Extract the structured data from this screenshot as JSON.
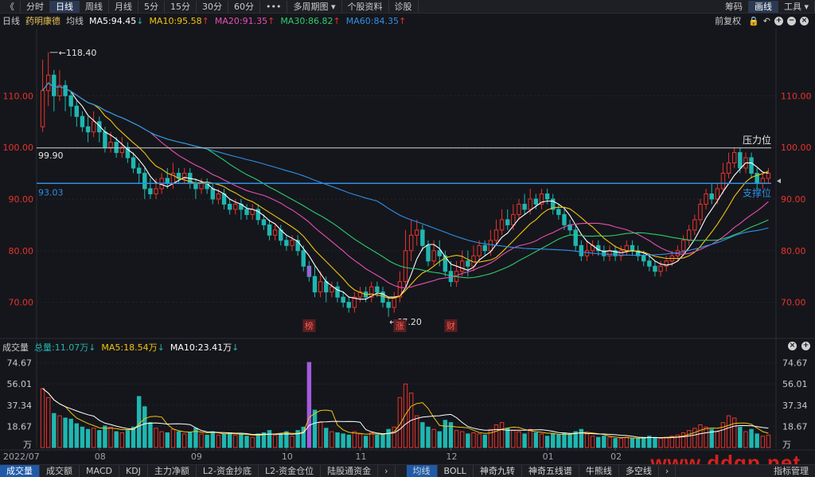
{
  "toolbar": {
    "back": "《",
    "items": [
      "分时",
      "日线",
      "周线",
      "月线",
      "5分",
      "15分",
      "30分",
      "60分",
      "•••",
      "多周期图 ▾",
      "个股资料",
      "诊股"
    ],
    "active_index": 1,
    "right_items": [
      "筹码",
      "画线",
      "工具 ▾"
    ],
    "right_active_index": 1
  },
  "ma_bar": {
    "period": "日线",
    "name": "药明康德",
    "type": "均线",
    "ma5": "MA5:94.45",
    "ma10": "MA10:95.58",
    "ma20": "MA20:91.35",
    "ma30": "MA30:86.82",
    "ma60": "MA60:84.35",
    "adjust": "前复权"
  },
  "vol_bar": {
    "label": "成交量",
    "total": "总量:11.07万",
    "ma5": "MA5:18.54万",
    "ma10": "MA10:23.41万"
  },
  "colors": {
    "up": "#e8332d",
    "down": "#1fb7b1",
    "ma5": "#ffffff",
    "ma10": "#f1c40f",
    "ma20": "#e84fb3",
    "ma30": "#2ecc71",
    "ma60": "#2f8fe8",
    "support": "#2f8fe8",
    "pressure": "#d0d0d0"
  },
  "bottom_tabs": [
    "成交量",
    "成交额",
    "MACD",
    "KDJ",
    "主力净额",
    "L2-资金抄底",
    "L2-资金仓位",
    "陆股通资金"
  ],
  "bottom_tabs2": [
    "均线",
    "BOLL",
    "神奇九转",
    "神奇五线谱",
    "牛熊线",
    "多空线"
  ],
  "bottom_right": "指标管理",
  "watermark": "www.ddgp.net",
  "chart_data": {
    "type": "candlestick",
    "title": "药明康德",
    "x_labels": [
      "2022/07",
      "08",
      "09",
      "10",
      "11",
      "12",
      "01",
      "02"
    ],
    "price_ticks": [
      110.0,
      100.0,
      90.0,
      80.0,
      70.0
    ],
    "ylim": [
      63.0,
      123.0
    ],
    "volume_ticks": [
      "74.67",
      "56.01",
      "37.34",
      "18.67",
      "万"
    ],
    "volume_ylim": [
      0,
      80
    ],
    "annotations": {
      "high": "118.40",
      "low": "67.20",
      "pressure_value": "99.90",
      "pressure_label": "压力位",
      "support_value": "93.03",
      "support_label": "支撑位",
      "events": [
        "榜",
        "涨",
        "财"
      ]
    },
    "candles": [
      [
        104,
        111,
        117,
        103,
        52
      ],
      [
        111,
        114,
        118.4,
        108,
        44
      ],
      [
        114,
        110,
        115,
        107,
        30
      ],
      [
        110,
        112,
        115,
        109,
        28
      ],
      [
        112,
        110,
        113,
        107,
        26
      ],
      [
        110,
        108,
        111,
        106,
        25
      ],
      [
        108,
        106,
        109,
        104,
        21
      ],
      [
        106,
        104,
        107,
        103,
        18
      ],
      [
        104,
        103,
        106,
        101,
        16
      ],
      [
        103,
        105,
        107,
        102,
        17
      ],
      [
        105,
        103,
        106,
        101,
        15
      ],
      [
        103,
        100,
        104,
        99,
        19
      ],
      [
        100,
        101,
        103,
        99,
        18
      ],
      [
        101,
        99,
        102,
        98,
        14
      ],
      [
        99,
        100,
        102,
        98,
        13
      ],
      [
        100,
        98,
        101,
        97,
        15
      ],
      [
        98,
        96,
        99,
        95,
        18
      ],
      [
        96,
        95,
        97,
        93,
        45
      ],
      [
        95,
        92,
        96,
        90,
        36
      ],
      [
        92,
        91,
        94,
        90,
        22
      ],
      [
        91,
        92,
        94,
        90,
        17
      ],
      [
        92,
        94,
        95,
        91,
        14
      ],
      [
        94,
        93,
        96,
        92,
        13
      ],
      [
        93,
        95,
        97,
        92,
        16
      ],
      [
        95,
        94,
        96,
        93,
        14
      ],
      [
        94,
        95,
        96,
        93,
        12
      ],
      [
        95,
        93,
        96,
        92,
        13
      ],
      [
        93,
        92,
        94,
        90,
        17
      ],
      [
        92,
        93,
        94,
        91,
        12
      ],
      [
        93,
        92,
        94,
        91,
        11
      ],
      [
        92,
        90,
        93,
        89,
        14
      ],
      [
        90,
        91,
        92,
        89,
        11
      ],
      [
        91,
        89,
        92,
        88,
        12
      ],
      [
        89,
        88,
        90,
        87,
        13
      ],
      [
        88,
        89,
        90,
        87,
        11
      ],
      [
        89,
        88,
        90,
        86,
        12
      ],
      [
        88,
        87,
        89,
        86,
        10
      ],
      [
        87,
        88,
        89,
        86,
        9
      ],
      [
        88,
        86,
        89,
        85,
        12
      ],
      [
        86,
        85,
        87,
        84,
        13
      ],
      [
        85,
        83,
        86,
        82,
        15
      ],
      [
        83,
        84,
        85,
        82,
        11
      ],
      [
        84,
        82,
        85,
        81,
        12
      ],
      [
        82,
        81,
        83,
        80,
        14
      ],
      [
        81,
        82,
        83,
        80,
        10
      ],
      [
        82,
        80,
        83,
        79,
        15
      ],
      [
        80,
        77,
        81,
        76,
        18
      ],
      [
        77,
        75,
        78,
        74,
        75
      ],
      [
        75,
        72,
        77,
        71,
        33
      ],
      [
        72,
        74,
        76,
        71,
        22
      ],
      [
        74,
        72,
        75,
        70,
        17
      ],
      [
        72,
        73,
        74,
        71,
        14
      ],
      [
        73,
        71,
        74,
        70,
        13
      ],
      [
        71,
        70,
        72,
        69,
        12
      ],
      [
        70,
        69,
        71,
        68,
        11
      ],
      [
        69,
        71,
        72,
        68,
        14
      ],
      [
        71,
        72,
        73,
        70,
        12
      ],
      [
        72,
        71,
        73,
        70,
        10
      ],
      [
        71,
        73,
        74,
        70,
        13
      ],
      [
        73,
        72,
        74,
        71,
        11
      ],
      [
        72,
        70,
        73,
        69,
        12
      ],
      [
        70,
        69,
        71,
        67.2,
        16
      ],
      [
        69,
        71,
        72,
        68,
        18
      ],
      [
        71,
        74,
        76,
        70,
        44
      ],
      [
        74,
        80,
        84,
        73,
        56
      ],
      [
        80,
        83,
        86,
        78,
        48
      ],
      [
        83,
        84,
        86,
        81,
        28
      ],
      [
        84,
        81,
        85,
        80,
        22
      ],
      [
        81,
        78,
        82,
        77,
        18
      ],
      [
        78,
        80,
        82,
        77,
        16
      ],
      [
        80,
        79,
        82,
        77,
        14
      ],
      [
        79,
        76,
        80,
        75,
        24
      ],
      [
        76,
        74,
        78,
        73,
        22
      ],
      [
        74,
        76,
        78,
        73,
        15
      ],
      [
        76,
        78,
        80,
        75,
        14
      ],
      [
        78,
        77,
        80,
        75,
        12
      ],
      [
        77,
        79,
        81,
        76,
        13
      ],
      [
        79,
        81,
        82,
        78,
        12
      ],
      [
        81,
        80,
        82,
        79,
        11
      ],
      [
        80,
        82,
        84,
        79,
        16
      ],
      [
        82,
        84,
        86,
        81,
        20
      ],
      [
        84,
        86,
        88,
        83,
        22
      ],
      [
        86,
        85,
        88,
        84,
        17
      ],
      [
        85,
        87,
        89,
        84,
        15
      ],
      [
        87,
        89,
        90,
        86,
        14
      ],
      [
        89,
        88,
        91,
        87,
        12
      ],
      [
        88,
        90,
        92,
        87,
        16
      ],
      [
        90,
        89,
        91,
        88,
        13
      ],
      [
        89,
        91,
        92,
        88,
        12
      ],
      [
        91,
        90,
        92,
        89,
        10
      ],
      [
        90,
        88,
        91,
        87,
        12
      ],
      [
        88,
        87,
        89,
        86,
        11
      ],
      [
        87,
        85,
        88,
        84,
        13
      ],
      [
        85,
        84,
        86,
        83,
        12
      ],
      [
        84,
        81,
        85,
        80,
        14
      ],
      [
        81,
        79,
        82,
        78,
        16
      ],
      [
        79,
        80,
        82,
        78,
        12
      ],
      [
        80,
        81,
        82,
        79,
        10
      ],
      [
        81,
        80,
        82,
        79,
        9
      ],
      [
        80,
        79,
        81,
        78,
        10
      ],
      [
        79,
        80,
        81,
        78,
        9
      ],
      [
        80,
        79,
        81,
        78,
        8
      ],
      [
        79,
        80,
        81,
        78,
        8
      ],
      [
        80,
        81,
        82,
        79,
        9
      ],
      [
        81,
        80,
        82,
        79,
        8
      ],
      [
        80,
        79,
        81,
        78,
        8
      ],
      [
        79,
        78,
        80,
        77,
        9
      ],
      [
        78,
        77,
        79,
        76,
        10
      ],
      [
        77,
        76,
        78,
        75,
        9
      ],
      [
        76,
        77,
        78,
        75,
        8
      ],
      [
        77,
        78,
        79,
        76,
        9
      ],
      [
        78,
        79,
        80,
        77,
        10
      ],
      [
        79,
        80,
        81,
        78,
        11
      ],
      [
        80,
        82,
        83,
        79,
        13
      ],
      [
        82,
        84,
        85,
        81,
        15
      ],
      [
        84,
        86,
        87,
        83,
        17
      ],
      [
        86,
        89,
        90,
        85,
        20
      ],
      [
        89,
        91,
        92,
        88,
        18
      ],
      [
        91,
        90,
        93,
        89,
        16
      ],
      [
        90,
        92,
        93,
        89,
        14
      ],
      [
        92,
        95,
        97,
        91,
        22
      ],
      [
        95,
        97,
        99,
        94,
        28
      ],
      [
        97,
        99,
        100,
        96,
        26
      ],
      [
        99,
        96,
        100,
        95,
        18
      ],
      [
        96,
        98,
        99,
        95,
        14
      ],
      [
        98,
        95,
        99,
        94,
        16
      ],
      [
        95,
        93,
        96,
        92,
        12
      ],
      [
        93,
        94,
        95,
        92,
        10
      ],
      [
        94,
        95,
        96,
        93,
        11
      ]
    ]
  }
}
